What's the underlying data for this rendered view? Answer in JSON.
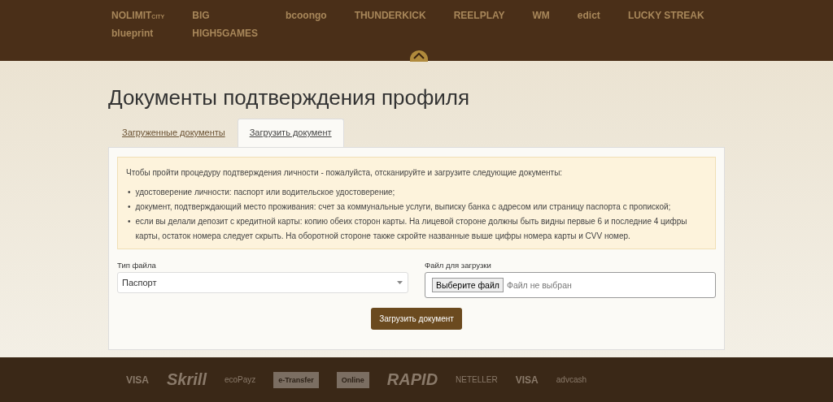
{
  "providers": [
    {
      "name": "NOLIMIT",
      "sub": "CITY"
    },
    {
      "name": "BIG"
    },
    {
      "name": "bcoongo"
    },
    {
      "name": "THUNDERKICK"
    },
    {
      "name": "REELPLAY"
    },
    {
      "name": "WM"
    },
    {
      "name": "edict"
    },
    {
      "name": "LUCKY STREAK"
    },
    {
      "name": "blueprint"
    },
    {
      "name": "HIGH5GAMES"
    }
  ],
  "title": "Документы подтверждения профиля",
  "tabs": [
    {
      "label": "Загруженные документы",
      "selected": false
    },
    {
      "label": "Загрузить документ",
      "selected": true
    }
  ],
  "info": {
    "intro": "Чтобы пройти процедуру подтверждения личности - пожалуйста, отсканируйте и загрузите следующие документы:",
    "items": [
      {
        "marker": "•",
        "text": "удостоверение личности: паспорт или водительское удостоверение;"
      },
      {
        "marker": "•",
        "text": "документ, подтверждающий место проживания: счет за коммунальные услуги, выписку банка с адресом или страницу паспорта с пропиской;"
      },
      {
        "marker": "•",
        "text": "если вы делали депозит с кредитной карты: копию обеих сторон карты. На лицевой стороне должны быть видны первые 6 и последние 4 цифры карты, остаток номера следует скрыть. На оборотной стороне также скройте названные выше цифры номера карты и CVV номер."
      }
    ]
  },
  "file_type": {
    "label": "Тип файла",
    "value": "Паспорт"
  },
  "file_upload": {
    "label": "Файл для загрузки",
    "button": "Выберите файл",
    "status": "Файл не выбран"
  },
  "submit": "Загрузить документ",
  "payments": [
    {
      "name": "VISA",
      "kind": "text"
    },
    {
      "name": "Skrill",
      "kind": "big"
    },
    {
      "name": "ecoPayz",
      "kind": "small"
    },
    {
      "name": "e-Transfer",
      "kind": "interac"
    },
    {
      "name": "Online",
      "kind": "interac"
    },
    {
      "name": "RAPID",
      "kind": "big"
    },
    {
      "name": "NETELLER",
      "kind": "small"
    },
    {
      "name": "VISA",
      "kind": "text"
    },
    {
      "name": "advcash",
      "kind": "small"
    }
  ]
}
